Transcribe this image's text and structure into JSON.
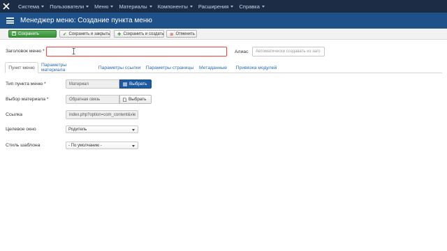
{
  "topnav": {
    "items": [
      "Система",
      "Пользователи",
      "Меню",
      "Материалы",
      "Компоненты",
      "Расширения",
      "Справка"
    ]
  },
  "titlebar": {
    "title": "Менеджер меню: Создание пункта меню"
  },
  "toolbar": {
    "save": "Сохранить",
    "save_close": "Сохранить и закрыть",
    "save_new": "Сохранить и создать",
    "cancel": "Отменить"
  },
  "form": {
    "title_label": "Заголовок меню",
    "title_required": "*",
    "title_value": "",
    "alias_label": "Алиас",
    "alias_placeholder": "Автоматически создавать из заго"
  },
  "tabs": [
    "Пункт меню",
    "Параметры материала",
    "Параметры ссылки",
    "Параметры страницы",
    "Метаданные",
    "Привязка модулей"
  ],
  "details": {
    "type_label": "Тип пункта меню",
    "type_required": "*",
    "type_value": "Материал",
    "type_button": "Выбрать",
    "article_label": "Выбор материала",
    "article_required": "*",
    "article_value": "Обратная связь",
    "article_button": "Выбрать",
    "link_label": "Ссылка",
    "link_value": "index.php?option=com_content&vie",
    "target_label": "Целевое окно",
    "target_value": "Родитель",
    "style_label": "Стиль шаблона",
    "style_value": "- По умолчанию -"
  },
  "colors": {
    "topnav_bg": "#1c2c45",
    "titlebar_bg": "#1e5089",
    "save_green": "#3a8f3a",
    "select_blue": "#1e5a9e",
    "link_blue": "#2a6ab8",
    "focus_red": "#d9534f"
  },
  "icons": {
    "logo": "joomla-logo-icon",
    "menu": "menu-list-icon",
    "save": "floppy-icon",
    "save_close": "check-icon",
    "save_new": "plus-icon",
    "cancel": "cancel-circle-icon",
    "select_type": "list-icon",
    "select_article": "file-icon"
  }
}
